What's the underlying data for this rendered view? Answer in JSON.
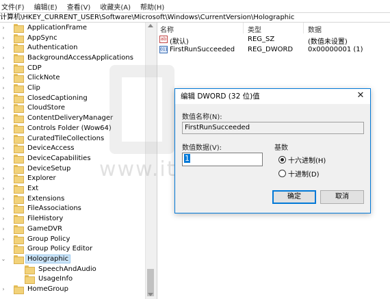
{
  "menu": [
    "文件(F)",
    "编辑(E)",
    "查看(V)",
    "收藏夹(A)",
    "帮助(H)"
  ],
  "address": "计算机\\HKEY_CURRENT_USER\\Software\\Microsoft\\Windows\\CurrentVersion\\Holographic",
  "tree": {
    "items": [
      "ApplicationFrame",
      "AppSync",
      "Authentication",
      "BackgroundAccessApplications",
      "CDP",
      "ClickNote",
      "Clip",
      "ClosedCaptioning",
      "CloudStore",
      "ContentDeliveryManager",
      "Controls Folder (Wow64)",
      "CuratedTileCollections",
      "DeviceAccess",
      "DeviceCapabilities",
      "DeviceSetup",
      "Explorer",
      "Ext",
      "Extensions",
      "FileAssociations",
      "FileHistory",
      "GameDVR",
      "Group Policy",
      "Group Policy Editor",
      "Holographic"
    ],
    "children": [
      "SpeechAndAudio",
      "UsageInfo"
    ],
    "after": "HomeGroup"
  },
  "values": {
    "headers": {
      "name": "名称",
      "type": "类型",
      "data": "数据"
    },
    "rows": [
      {
        "icon": "string-value-icon",
        "name": "(默认)",
        "type": "REG_SZ",
        "data": "(数值未设置)"
      },
      {
        "icon": "binary-value-icon",
        "name": "FirstRunSucceeded",
        "type": "REG_DWORD",
        "data": "0x00000001 (1)"
      }
    ]
  },
  "watermark": "www.ithome.com",
  "dialog": {
    "title": "编辑 DWORD (32 位)值",
    "name_label": "数值名称(N):",
    "name_value": "FirstRunSucceeded",
    "data_label": "数值数据(V):",
    "data_value": "1",
    "base_label": "基数",
    "hex_label": "十六进制(H)",
    "dec_label": "十进制(D)",
    "ok": "确定",
    "cancel": "取消"
  }
}
